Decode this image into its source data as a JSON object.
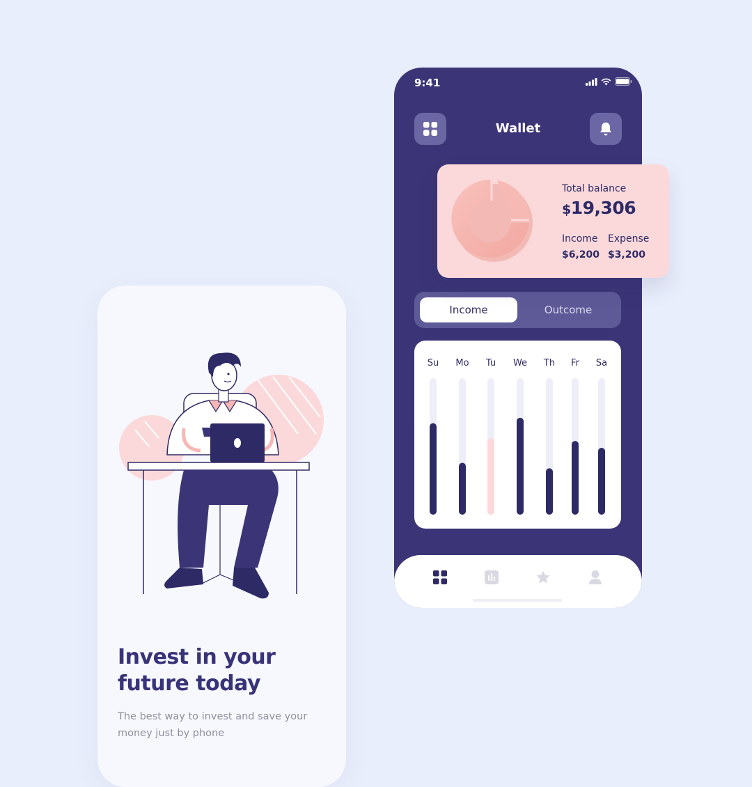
{
  "onboarding": {
    "title": "Invest in your future today",
    "subtitle": "The best way to invest and save your money just by phone"
  },
  "status_bar": {
    "time": "9:41"
  },
  "wallet": {
    "title": "Wallet",
    "balance": {
      "label": "Total balance",
      "currency": "$",
      "amount": "19,306",
      "income_label": "Income",
      "income_value": "$6,200",
      "expense_label": "Expense",
      "expense_value": "$3,200"
    },
    "toggle": {
      "active": "Income",
      "inactive": "Outcome"
    }
  },
  "chart_data": {
    "type": "bar",
    "categories": [
      "Su",
      "Mo",
      "Tu",
      "We",
      "Th",
      "Fr",
      "Sa"
    ],
    "values": [
      0.67,
      0.38,
      0.56,
      0.71,
      0.34,
      0.54,
      0.49
    ],
    "highlight_index": 2,
    "ylim": [
      0,
      1
    ],
    "colors": {
      "bar": "#2e2a66",
      "highlight": "#fbd9da",
      "track": "#eeeef8"
    }
  },
  "tabbar": {
    "items": [
      {
        "icon": "home-grid-icon",
        "active": true
      },
      {
        "icon": "chart-icon",
        "active": false
      },
      {
        "icon": "star-icon",
        "active": false
      },
      {
        "icon": "profile-icon",
        "active": false
      }
    ]
  },
  "colors": {
    "background": "#e9eefc",
    "phone": "#3b3577",
    "accent_dark": "#2e2a66",
    "accent_pink": "#fbd9da"
  }
}
